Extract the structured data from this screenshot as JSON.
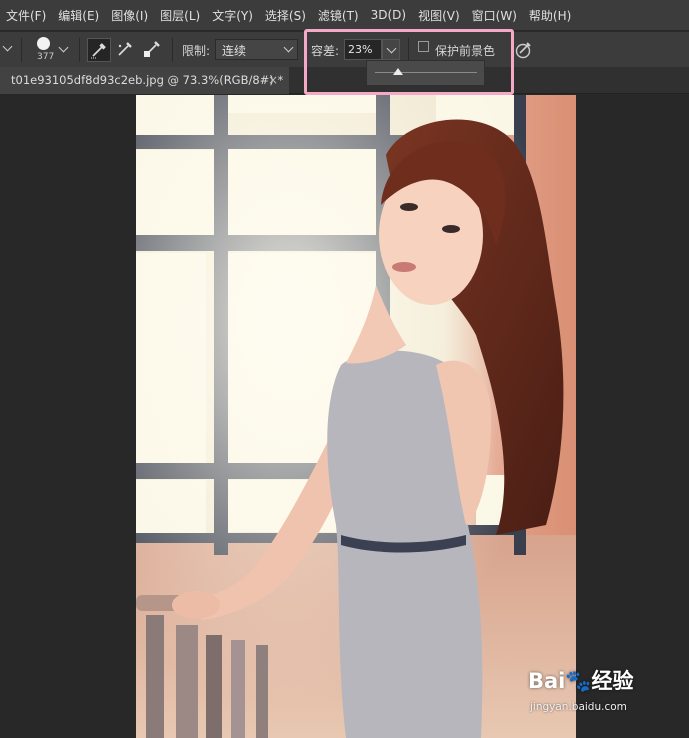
{
  "menu": {
    "items": [
      "文件(F)",
      "编辑(E)",
      "图像(I)",
      "图层(L)",
      "文字(Y)",
      "选择(S)",
      "滤镜(T)",
      "3D(D)",
      "视图(V)",
      "窗口(W)",
      "帮助(H)"
    ]
  },
  "options": {
    "brush_size": "377",
    "limit_label": "限制:",
    "limit_value": "连续",
    "tolerance_label": "容差:",
    "tolerance_value": "23%",
    "tolerance_fraction": 0.23,
    "protect_fg_label": "保护前景色",
    "protect_fg_checked": false
  },
  "document": {
    "tab_title": "t01e93105df8d93c2eb.jpg @ 73.3%(RGB/8#) *",
    "close_glyph": "×"
  },
  "watermark": {
    "logo_text": "Bai🐾经验",
    "url": "jingyan.baidu.com"
  },
  "colors": {
    "highlight": "#f4aac6",
    "menubar_bg": "#3c3c3c",
    "workspace_bg": "#282828"
  }
}
